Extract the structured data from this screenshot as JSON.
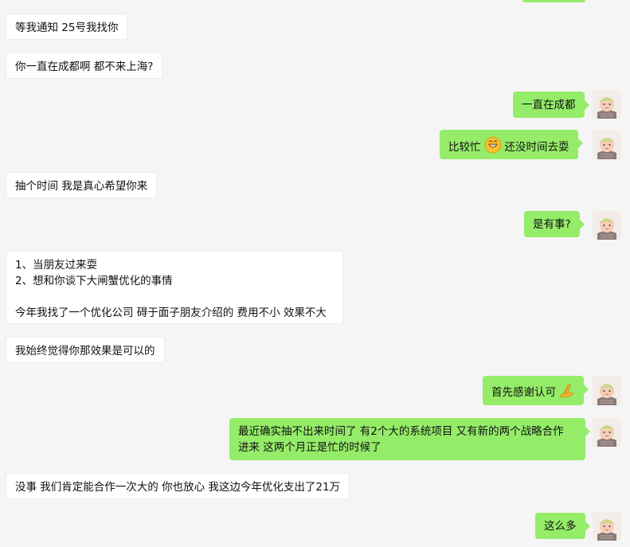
{
  "messages": [
    {
      "id": "m1",
      "side": "in",
      "text": "等我通知 25号我找你"
    },
    {
      "id": "m2",
      "side": "in",
      "text": "你一直在成都啊 都不来上海?"
    },
    {
      "id": "m3",
      "side": "out",
      "text": "一直在成都"
    },
    {
      "id": "m4",
      "side": "out",
      "text_before": "比较忙",
      "emoji": "grinning-face-emoji",
      "text_after": "还没时间去耍"
    },
    {
      "id": "m5",
      "side": "in",
      "text": "抽个时间 我是真心希望你来"
    },
    {
      "id": "m6",
      "side": "out",
      "text": "是有事?"
    },
    {
      "id": "m7",
      "side": "in",
      "lines": [
        "1、当朋友过来耍",
        "2、想和你谈下大闸蟹优化的事情",
        "",
        "今年我找了一个优化公司 碍于面子朋友介绍的 费用不小 效果不大"
      ]
    },
    {
      "id": "m8",
      "side": "in",
      "text": "我始终觉得你那效果是可以的"
    },
    {
      "id": "m9",
      "side": "out",
      "text": "首先感谢认可",
      "emoji": "pray-hands-emoji"
    },
    {
      "id": "m10",
      "side": "out",
      "lines": [
        "最近确实抽不出来时间了 有2个大的系统项目  又有新的两个战略合作",
        "进来 这两个月正是忙的时候了"
      ]
    },
    {
      "id": "m11",
      "side": "in",
      "text": "没事  我们肯定能合作一次大的 你也放心 我这边今年优化支出了21万"
    },
    {
      "id": "m12",
      "side": "out",
      "text": "这么多"
    }
  ],
  "colors": {
    "background": "#f5f5f5",
    "incoming_bubble": "#ffffff",
    "outgoing_bubble": "#95ec69"
  },
  "avatar": {
    "icon": "baby-avatar-icon"
  }
}
